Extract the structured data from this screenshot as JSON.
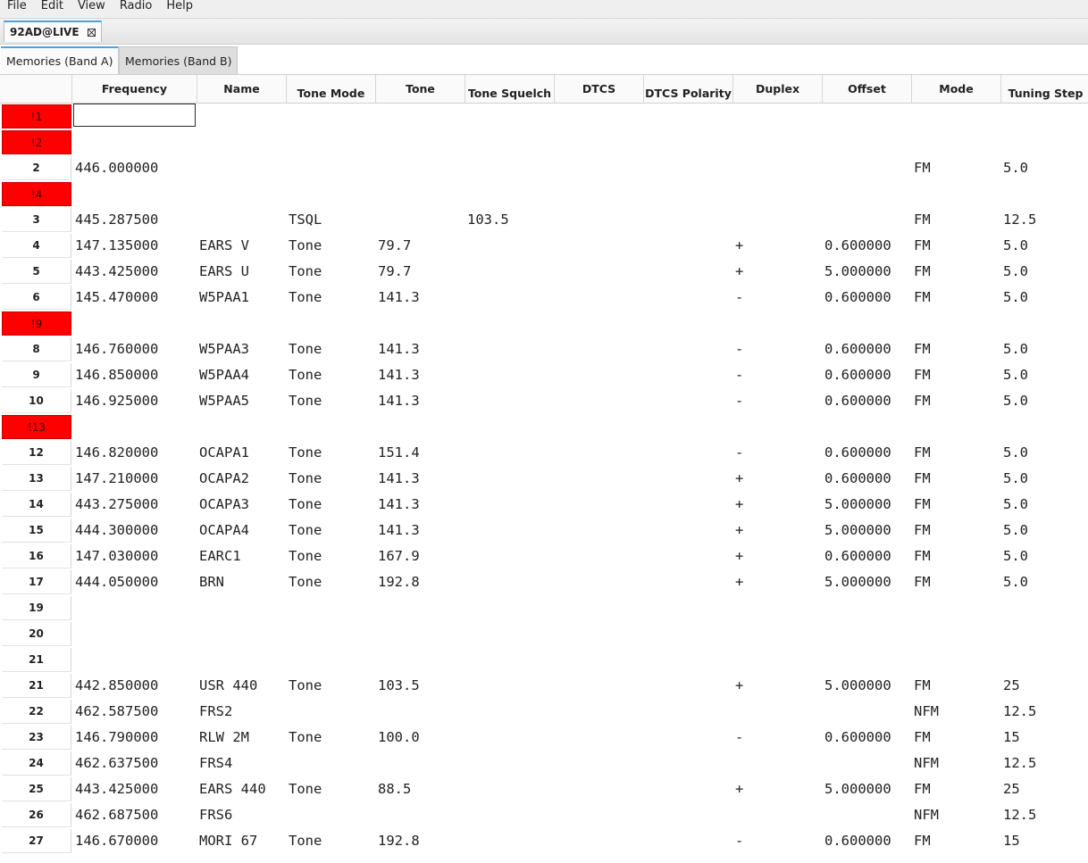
{
  "menu": [
    "File",
    "Edit",
    "View",
    "Radio",
    "Help"
  ],
  "document_tab": {
    "label": "92AD@LIVE"
  },
  "band_tabs": [
    "Memories (Band A)",
    "Memories (Band B)"
  ],
  "columns": [
    {
      "key": "freq",
      "label": "Frequency"
    },
    {
      "key": "name",
      "label": "Name"
    },
    {
      "key": "tmode",
      "label": "Tone Mode"
    },
    {
      "key": "tone",
      "label": "Tone"
    },
    {
      "key": "tsql",
      "label": "Tone Squelch"
    },
    {
      "key": "dtcs",
      "label": "DTCS"
    },
    {
      "key": "dtcspol",
      "label": "DTCS Polarity"
    },
    {
      "key": "duplex",
      "label": "Duplex"
    },
    {
      "key": "offset",
      "label": "Offset"
    },
    {
      "key": "mode",
      "label": "Mode"
    },
    {
      "key": "step",
      "label": "Tuning Step"
    }
  ],
  "rows": [
    {
      "num": "!1",
      "empty": true,
      "selected": true
    },
    {
      "num": "!2",
      "empty": true
    },
    {
      "num": "2",
      "freq": "446.000000",
      "mode": "FM",
      "step": "5.0"
    },
    {
      "num": "!4",
      "empty": true
    },
    {
      "num": "3",
      "freq": "445.287500",
      "tmode": "TSQL",
      "tsql": "103.5",
      "mode": "FM",
      "step": "12.5"
    },
    {
      "num": "4",
      "freq": "147.135000",
      "name": "EARS V",
      "tmode": "Tone",
      "tone": "79.7",
      "duplex": "+",
      "offset": "0.600000",
      "mode": "FM",
      "step": "5.0"
    },
    {
      "num": "5",
      "freq": "443.425000",
      "name": "EARS U",
      "tmode": "Tone",
      "tone": "79.7",
      "duplex": "+",
      "offset": "5.000000",
      "mode": "FM",
      "step": "5.0"
    },
    {
      "num": "6",
      "freq": "145.470000",
      "name": "W5PAA1",
      "tmode": "Tone",
      "tone": "141.3",
      "duplex": "-",
      "offset": "0.600000",
      "mode": "FM",
      "step": "5.0"
    },
    {
      "num": "!9",
      "empty": true
    },
    {
      "num": "8",
      "freq": "146.760000",
      "name": "W5PAA3",
      "tmode": "Tone",
      "tone": "141.3",
      "duplex": "-",
      "offset": "0.600000",
      "mode": "FM",
      "step": "5.0"
    },
    {
      "num": "9",
      "freq": "146.850000",
      "name": "W5PAA4",
      "tmode": "Tone",
      "tone": "141.3",
      "duplex": "-",
      "offset": "0.600000",
      "mode": "FM",
      "step": "5.0"
    },
    {
      "num": "10",
      "freq": "146.925000",
      "name": "W5PAA5",
      "tmode": "Tone",
      "tone": "141.3",
      "duplex": "-",
      "offset": "0.600000",
      "mode": "FM",
      "step": "5.0"
    },
    {
      "num": "!13",
      "empty": true
    },
    {
      "num": "12",
      "freq": "146.820000",
      "name": "OCAPA1",
      "tmode": "Tone",
      "tone": "151.4",
      "duplex": "-",
      "offset": "0.600000",
      "mode": "FM",
      "step": "5.0"
    },
    {
      "num": "13",
      "freq": "147.210000",
      "name": "OCAPA2",
      "tmode": "Tone",
      "tone": "141.3",
      "duplex": "+",
      "offset": "0.600000",
      "mode": "FM",
      "step": "5.0"
    },
    {
      "num": "14",
      "freq": "443.275000",
      "name": "OCAPA3",
      "tmode": "Tone",
      "tone": "141.3",
      "duplex": "+",
      "offset": "5.000000",
      "mode": "FM",
      "step": "5.0"
    },
    {
      "num": "15",
      "freq": "444.300000",
      "name": "OCAPA4",
      "tmode": "Tone",
      "tone": "141.3",
      "duplex": "+",
      "offset": "5.000000",
      "mode": "FM",
      "step": "5.0"
    },
    {
      "num": "16",
      "freq": "147.030000",
      "name": "EARC1",
      "tmode": "Tone",
      "tone": "167.9",
      "duplex": "+",
      "offset": "0.600000",
      "mode": "FM",
      "step": "5.0"
    },
    {
      "num": "17",
      "freq": "444.050000",
      "name": "BRN",
      "tmode": "Tone",
      "tone": "192.8",
      "duplex": "+",
      "offset": "5.000000",
      "mode": "FM",
      "step": "5.0"
    },
    {
      "num": "19"
    },
    {
      "num": "20"
    },
    {
      "num": "21"
    },
    {
      "num": "21",
      "freq": "442.850000",
      "name": "USR 440",
      "tmode": "Tone",
      "tone": "103.5",
      "duplex": "+",
      "offset": "5.000000",
      "mode": "FM",
      "step": "25"
    },
    {
      "num": "22",
      "freq": "462.587500",
      "name": "FRS2",
      "mode": "NFM",
      "step": "12.5"
    },
    {
      "num": "23",
      "freq": "146.790000",
      "name": "RLW 2M",
      "tmode": "Tone",
      "tone": "100.0",
      "duplex": "-",
      "offset": "0.600000",
      "mode": "FM",
      "step": "15"
    },
    {
      "num": "24",
      "freq": "462.637500",
      "name": "FRS4",
      "mode": "NFM",
      "step": "12.5"
    },
    {
      "num": "25",
      "freq": "443.425000",
      "name": "EARS 440",
      "tmode": "Tone",
      "tone": "88.5",
      "duplex": "+",
      "offset": "5.000000",
      "mode": "FM",
      "step": "25"
    },
    {
      "num": "26",
      "freq": "462.687500",
      "name": "FRS6",
      "mode": "NFM",
      "step": "12.5"
    },
    {
      "num": "27",
      "freq": "146.670000",
      "name": "MORI 67",
      "tmode": "Tone",
      "tone": "192.8",
      "duplex": "-",
      "offset": "0.600000",
      "mode": "FM",
      "step": "15"
    }
  ]
}
